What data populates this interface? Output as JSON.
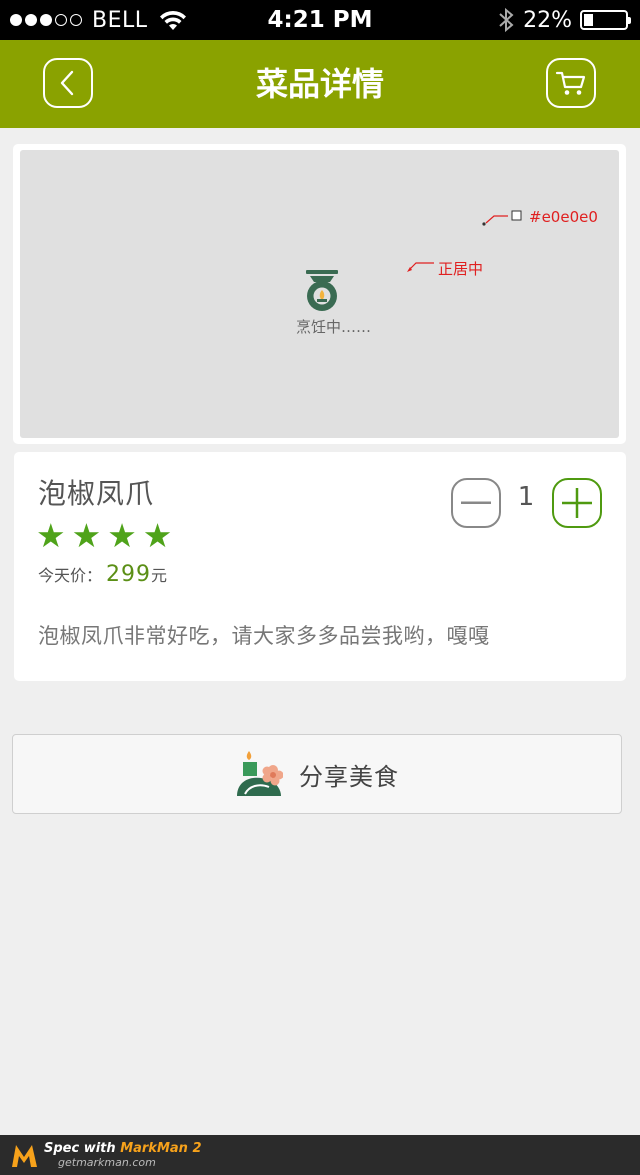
{
  "status_bar": {
    "carrier": "BELL",
    "time": "4:21 PM",
    "battery": "22%",
    "battery_level": 0.22,
    "signal_bars_filled": 3,
    "signal_bars_total": 5
  },
  "nav": {
    "title": "菜品详情",
    "back_icon": "chevron-left-icon",
    "cart_icon": "cart-icon",
    "color": "#8aa200"
  },
  "image": {
    "placeholder_color": "#e0e0e0",
    "loading_text": "烹饪中……",
    "annotations": {
      "color_note": "#e0e0e0",
      "center_note": "正居中"
    }
  },
  "dish": {
    "name": "泡椒凤爪",
    "rating": 4,
    "price_label": "今天价：",
    "price_value": "299",
    "price_unit": "元",
    "description": "泡椒凤爪非常好吃，请大家多多品尝我哟，嘎嘎",
    "quantity": "1",
    "accent_color": "#4fa31a"
  },
  "share": {
    "label": "分享美食",
    "icon": "share-food-icon"
  },
  "footer": {
    "line1_prefix": "Spec with ",
    "line1_brand": "MarkMan 2",
    "line2": "getmarkman.com"
  }
}
